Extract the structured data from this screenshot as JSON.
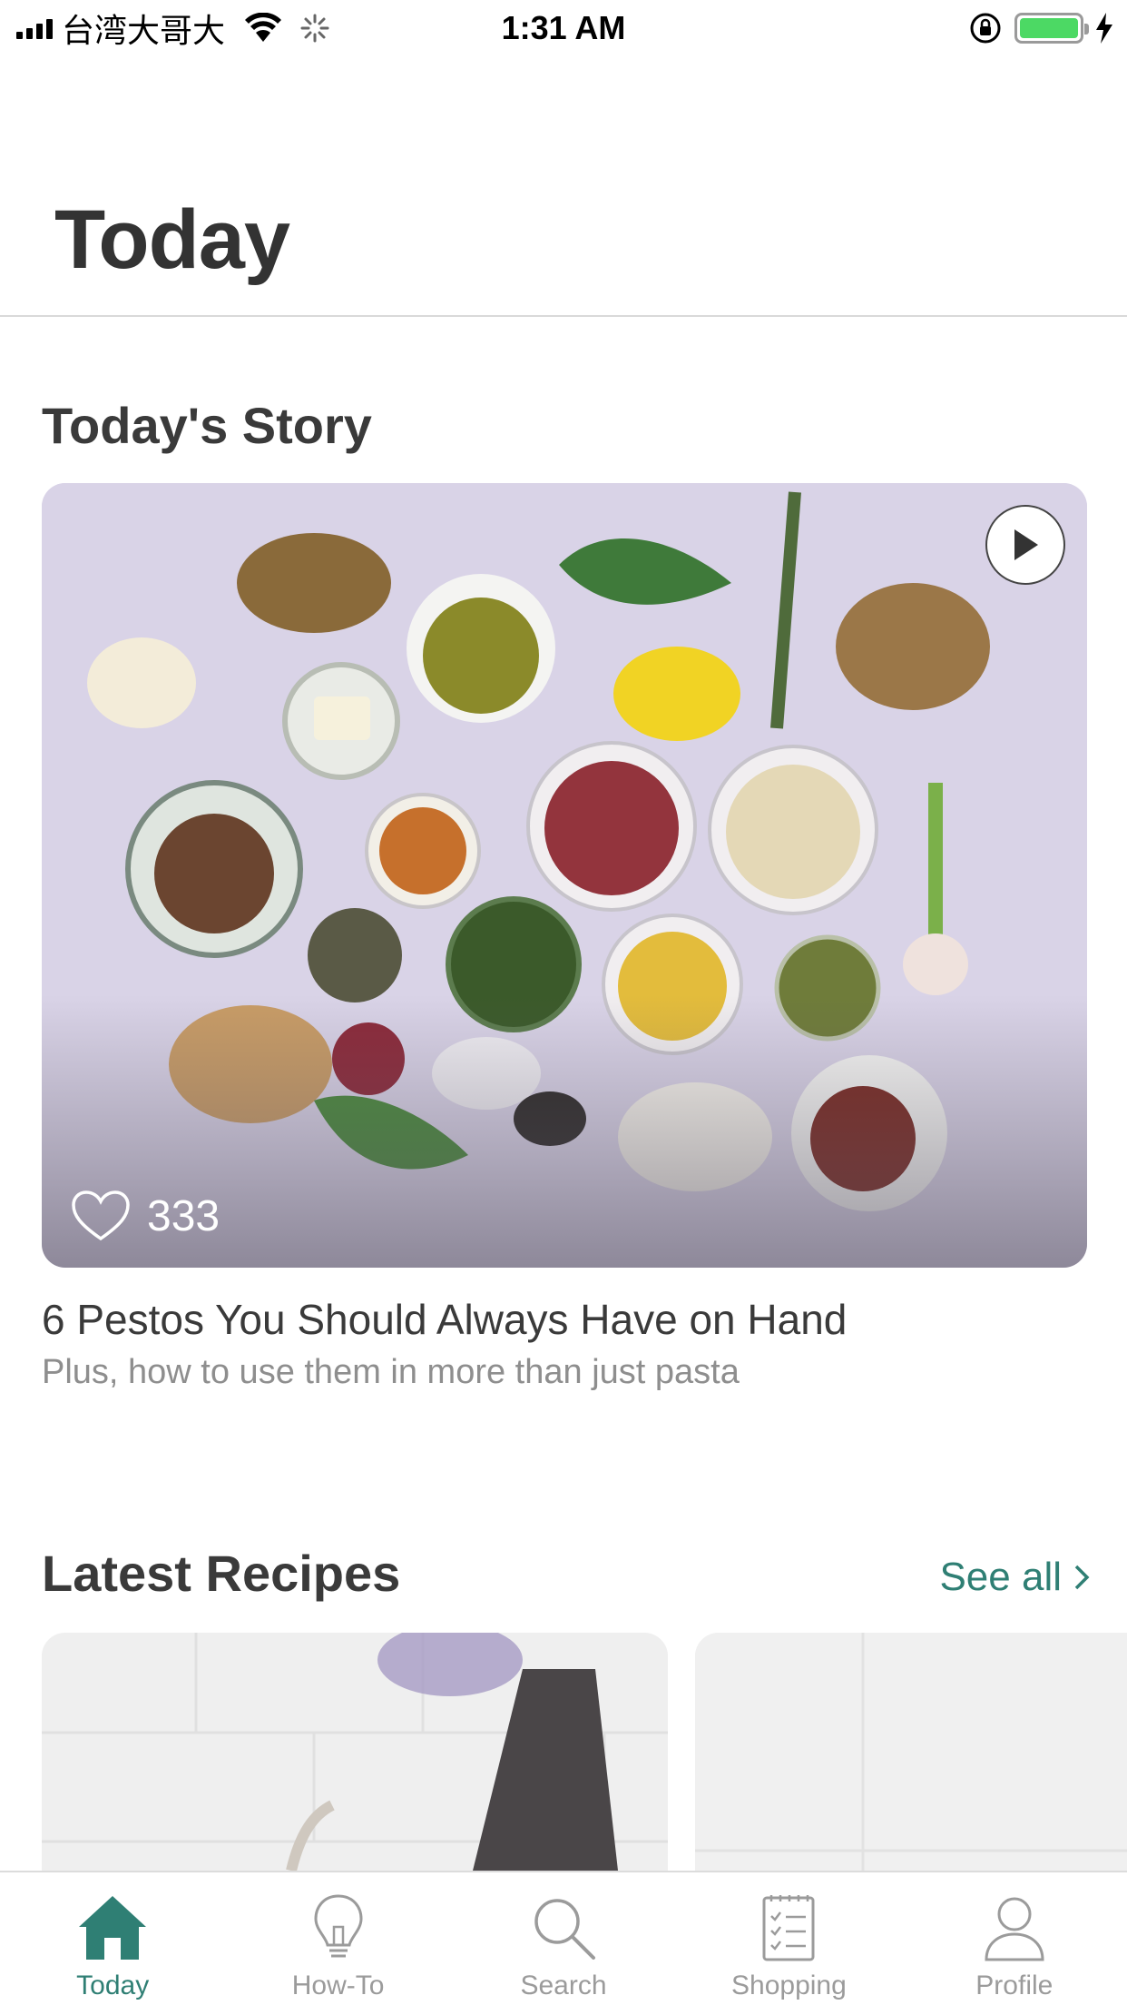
{
  "status_bar": {
    "carrier": "台湾大哥大",
    "time": "1:31 AM"
  },
  "page": {
    "title": "Today"
  },
  "story": {
    "section_title": "Today's Story",
    "like_count": "333",
    "headline": "6 Pestos You Should Always Have on Hand",
    "subtitle": "Plus, how to use them in more than just pasta"
  },
  "latest": {
    "section_title": "Latest Recipes",
    "see_all_label": "See all"
  },
  "tabs": [
    {
      "label": "Today",
      "icon": "home-icon",
      "active": true
    },
    {
      "label": "How-To",
      "icon": "lightbulb-icon",
      "active": false
    },
    {
      "label": "Search",
      "icon": "search-icon",
      "active": false
    },
    {
      "label": "Shopping",
      "icon": "shopping-list-icon",
      "active": false
    },
    {
      "label": "Profile",
      "icon": "profile-icon",
      "active": false
    }
  ],
  "colors": {
    "accent": "#2f7f74",
    "tab_inactive": "#9b9b9b",
    "battery": "#4cd964"
  }
}
